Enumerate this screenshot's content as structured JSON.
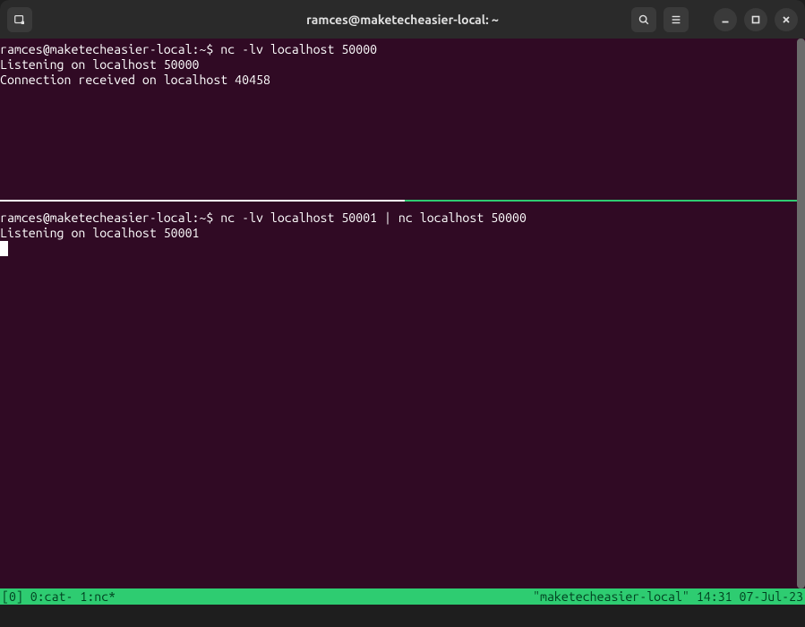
{
  "titlebar": {
    "title": "ramces@maketecheasier-local: ~"
  },
  "pane_top": {
    "prompt": "ramces@maketecheasier-local:~$ ",
    "command": "nc -lv localhost 50000",
    "output_line1": "Listening on localhost 50000",
    "output_line2": "Connection received on localhost 40458"
  },
  "pane_bottom": {
    "prompt": "ramces@maketecheasier-local:~$ ",
    "command": "nc -lv localhost 50001 | nc localhost 50000",
    "output_line1": "Listening on localhost 50001"
  },
  "statusbar": {
    "left": "[0] 0:cat- 1:nc*",
    "right": "\"maketecheasier-local\" 14:31 07-Jul-23"
  },
  "divider": {
    "white_width": 452,
    "green_width": 438
  }
}
